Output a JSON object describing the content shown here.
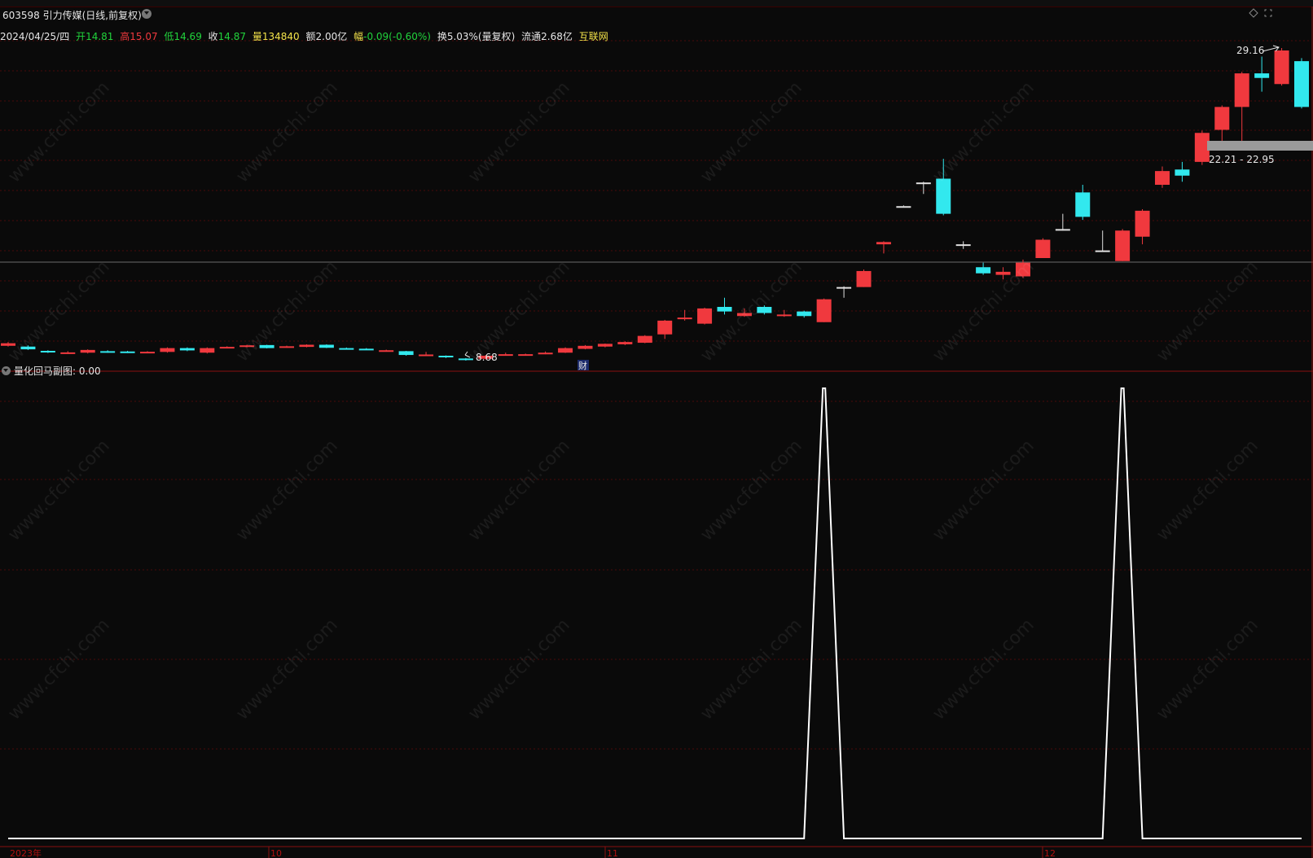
{
  "stock": {
    "code_name": "603598 引力传媒(日线,前复权)"
  },
  "info": {
    "date": "2024/04/25/四",
    "open_label": "开",
    "open": "14.81",
    "high_label": "高",
    "high": "15.07",
    "low_label": "低",
    "low": "14.69",
    "close_label": "收",
    "close": "14.87",
    "volume_label": "量",
    "volume": "134840",
    "amount_label": "额",
    "amount": "2.00亿",
    "change_label": "幅",
    "change": "-0.09(-0.60%)",
    "turnover": "换5.03%(量复权)",
    "float": "流通2.68亿",
    "sector": "互联网"
  },
  "annotations": {
    "high_price": "29.16",
    "low_price": "8.68",
    "range_band": "22.21 - 22.95",
    "event_marker": "财"
  },
  "indicator": {
    "title": "量化回马副图",
    "value": ": 0.00"
  },
  "date_axis": {
    "labels": [
      "2023年",
      "10",
      "11",
      "12"
    ]
  },
  "colors": {
    "up": "#f0393e",
    "down": "#32e8ee",
    "flat": "#e0e0e0",
    "grid": "#4a0a0a",
    "indicator_line": "#ffffff",
    "highlight": "#f3e34a",
    "open_color": "#21d33c",
    "high_color": "#f0393e",
    "low_color": "#21d33c",
    "close_color": "#21d33c",
    "volume_color": "#f3e34a"
  },
  "chart_data": [
    {
      "type": "candlestick",
      "title": "",
      "xlabel": "",
      "ylabel": "",
      "ylim": [
        8.0,
        30.0
      ],
      "series": [
        {
          "name": "",
          "values": [
            {
              "o": 9.65,
              "c": 9.82,
              "h": 9.9,
              "l": 9.6
            },
            {
              "o": 9.6,
              "c": 9.42,
              "h": 9.68,
              "l": 9.38
            },
            {
              "o": 9.32,
              "c": 9.22,
              "h": 9.36,
              "l": 9.18
            },
            {
              "o": 9.15,
              "c": 9.22,
              "h": 9.3,
              "l": 9.12
            },
            {
              "o": 9.2,
              "c": 9.38,
              "h": 9.42,
              "l": 9.15
            },
            {
              "o": 9.3,
              "c": 9.26,
              "h": 9.36,
              "l": 9.2
            },
            {
              "o": 9.28,
              "c": 9.24,
              "h": 9.32,
              "l": 9.18
            },
            {
              "o": 9.22,
              "c": 9.26,
              "h": 9.3,
              "l": 9.2
            },
            {
              "o": 9.25,
              "c": 9.5,
              "h": 9.55,
              "l": 9.2
            },
            {
              "o": 9.5,
              "c": 9.35,
              "h": 9.55,
              "l": 9.3
            },
            {
              "o": 9.2,
              "c": 9.5,
              "h": 9.55,
              "l": 9.15
            },
            {
              "o": 9.52,
              "c": 9.58,
              "h": 9.62,
              "l": 9.5
            },
            {
              "o": 9.6,
              "c": 9.68,
              "h": 9.72,
              "l": 9.55
            },
            {
              "o": 9.7,
              "c": 9.5,
              "h": 9.72,
              "l": 9.48
            },
            {
              "o": 9.58,
              "c": 9.62,
              "h": 9.66,
              "l": 9.52
            },
            {
              "o": 9.58,
              "c": 9.72,
              "h": 9.75,
              "l": 9.55
            },
            {
              "o": 9.72,
              "c": 9.52,
              "h": 9.75,
              "l": 9.5
            },
            {
              "o": 9.5,
              "c": 9.46,
              "h": 9.54,
              "l": 9.42
            },
            {
              "o": 9.46,
              "c": 9.42,
              "h": 9.5,
              "l": 9.38
            },
            {
              "o": 9.32,
              "c": 9.36,
              "h": 9.4,
              "l": 9.28
            },
            {
              "o": 9.3,
              "c": 9.05,
              "h": 9.32,
              "l": 9.0
            },
            {
              "o": 9.0,
              "c": 9.08,
              "h": 9.25,
              "l": 8.98
            },
            {
              "o": 9.0,
              "c": 8.9,
              "h": 9.02,
              "l": 8.85
            },
            {
              "o": 8.82,
              "c": 8.72,
              "h": 8.85,
              "l": 8.68
            },
            {
              "o": 8.8,
              "c": 9.0,
              "h": 9.05,
              "l": 8.75
            },
            {
              "o": 9.06,
              "c": 9.1,
              "h": 9.2,
              "l": 9.0
            },
            {
              "o": 9.08,
              "c": 9.1,
              "h": 9.14,
              "l": 9.05
            },
            {
              "o": 9.15,
              "c": 9.2,
              "h": 9.28,
              "l": 9.1
            },
            {
              "o": 9.2,
              "c": 9.5,
              "h": 9.55,
              "l": 9.18
            },
            {
              "o": 9.45,
              "c": 9.65,
              "h": 9.7,
              "l": 9.42
            },
            {
              "o": 9.6,
              "c": 9.78,
              "h": 9.8,
              "l": 9.55
            },
            {
              "o": 9.75,
              "c": 9.9,
              "h": 9.95,
              "l": 9.7
            },
            {
              "o": 9.85,
              "c": 10.3,
              "h": 10.35,
              "l": 9.82
            },
            {
              "o": 10.4,
              "c": 11.3,
              "h": 11.35,
              "l": 10.1
            },
            {
              "o": 11.4,
              "c": 11.5,
              "h": 12.0,
              "l": 11.3
            },
            {
              "o": 11.1,
              "c": 12.1,
              "h": 12.15,
              "l": 11.05
            },
            {
              "o": 12.2,
              "c": 11.9,
              "h": 12.8,
              "l": 11.7
            },
            {
              "o": 11.6,
              "c": 11.8,
              "h": 12.1,
              "l": 11.55
            },
            {
              "o": 12.2,
              "c": 11.8,
              "h": 12.3,
              "l": 11.7
            },
            {
              "o": 11.6,
              "c": 11.7,
              "h": 12.0,
              "l": 11.55
            },
            {
              "o": 11.9,
              "c": 11.6,
              "h": 11.95,
              "l": 11.5
            },
            {
              "o": 11.2,
              "c": 12.7,
              "h": 12.75,
              "l": 11.2
            },
            {
              "o": 13.5,
              "c": 13.5,
              "h": 13.55,
              "l": 12.8
            },
            {
              "o": 13.5,
              "c": 14.55,
              "h": 14.65,
              "l": 13.5
            },
            {
              "o": 16.3,
              "c": 16.45,
              "h": 16.5,
              "l": 15.7
            },
            {
              "o": 18.8,
              "c": 18.8,
              "h": 18.85,
              "l": 18.8
            },
            {
              "o": 20.35,
              "c": 20.35,
              "h": 20.4,
              "l": 19.6
            },
            {
              "o": 20.6,
              "c": 18.3,
              "h": 21.9,
              "l": 18.2
            },
            {
              "o": 16.3,
              "c": 16.3,
              "h": 16.5,
              "l": 16.0
            },
            {
              "o": 14.8,
              "c": 14.4,
              "h": 15.1,
              "l": 14.3
            },
            {
              "o": 14.3,
              "c": 14.5,
              "h": 14.8,
              "l": 14.0
            },
            {
              "o": 14.2,
              "c": 15.1,
              "h": 15.3,
              "l": 14.1
            },
            {
              "o": 15.4,
              "c": 16.6,
              "h": 16.7,
              "l": 15.4
            },
            {
              "o": 17.3,
              "c": 17.3,
              "h": 18.3,
              "l": 17.2
            },
            {
              "o": 19.7,
              "c": 18.1,
              "h": 20.2,
              "l": 17.9
            },
            {
              "o": 15.9,
              "c": 15.9,
              "h": 17.2,
              "l": 15.8
            },
            {
              "o": 15.2,
              "c": 17.2,
              "h": 17.3,
              "l": 15.2
            },
            {
              "o": 16.8,
              "c": 18.5,
              "h": 18.6,
              "l": 16.3
            },
            {
              "o": 20.2,
              "c": 21.1,
              "h": 21.4,
              "l": 20.0
            },
            {
              "o": 21.2,
              "c": 20.8,
              "h": 21.7,
              "l": 20.4
            },
            {
              "o": 21.7,
              "c": 23.6,
              "h": 23.75,
              "l": 21.5
            },
            {
              "o": 23.8,
              "c": 25.3,
              "h": 25.4,
              "l": 22.9
            },
            {
              "o": 25.3,
              "c": 27.5,
              "h": 27.6,
              "l": 23.0
            },
            {
              "o": 27.5,
              "c": 27.2,
              "h": 28.6,
              "l": 26.3
            },
            {
              "o": 26.8,
              "c": 29.0,
              "h": 29.16,
              "l": 26.7
            },
            {
              "o": 28.3,
              "c": 25.3,
              "h": 28.5,
              "l": 25.2
            }
          ]
        }
      ]
    },
    {
      "type": "line",
      "title": "",
      "xlabel": "",
      "ylabel": "",
      "ylim": [
        0,
        1
      ],
      "series": [
        {
          "name": "",
          "values": [
            0,
            0,
            0,
            0,
            0,
            0,
            0,
            0,
            0,
            0,
            0,
            0,
            0,
            0,
            0,
            0,
            0,
            0,
            0,
            0,
            0,
            0,
            0,
            0,
            0,
            0,
            0,
            0,
            0,
            0,
            0,
            0,
            0,
            0,
            0,
            0,
            0,
            0,
            0,
            0,
            0,
            1,
            0,
            0,
            0,
            0,
            0,
            0,
            0,
            0,
            0,
            0,
            0,
            0,
            0,
            0,
            1,
            0,
            0,
            0,
            0,
            0,
            0,
            0,
            0,
            0
          ]
        }
      ]
    }
  ]
}
